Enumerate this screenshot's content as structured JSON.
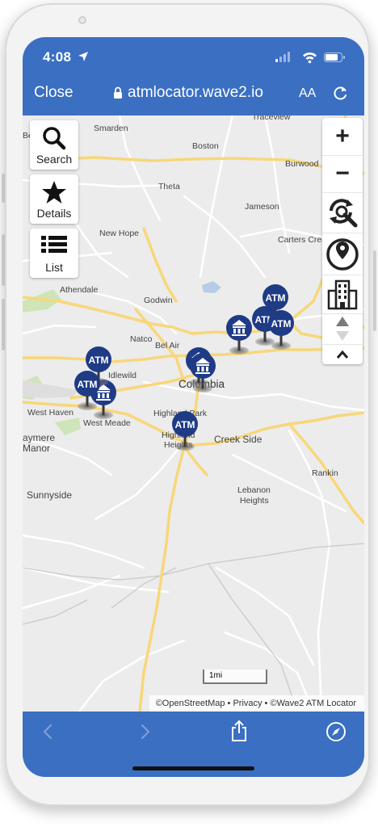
{
  "status": {
    "time": "4:08"
  },
  "browser": {
    "close_label": "Close",
    "url": "atmlocator.wave2.io",
    "text_size_label": "AA"
  },
  "controls": {
    "search_label": "Search",
    "details_label": "Details",
    "list_label": "List"
  },
  "map_controls": {
    "zoom_in": "+",
    "zoom_out": "−"
  },
  "places": {
    "traceview": "Traceview",
    "smarden": "Smarden",
    "boston": "Boston",
    "bethel": "Bethel",
    "burwood": "Burwood",
    "theta": "Theta",
    "jameson": "Jameson",
    "new_hope": "New Hope",
    "carters_creek": "Carters Cree",
    "athendale": "Athendale",
    "godwin": "Godwin",
    "natco": "Natco",
    "bel_air": "Bel Air",
    "idlewild": "Idlewild",
    "columbia": "Columbia",
    "west_haven": "West Haven",
    "west_meade": "West Meade",
    "highland_park": "Highland Park",
    "highland_heights_1": "Highland",
    "highland_heights_2": "Heights",
    "aymere_manor_1": "aymere",
    "aymere_manor_2": "Manor",
    "creek_side": "Creek Side",
    "rankin": "Rankin",
    "sunnyside": "Sunnyside",
    "lebanon_heights_1": "Lebanon",
    "lebanon_heights_2": "Heights"
  },
  "markers": {
    "atm_label": "ATM"
  },
  "scale_label": "1mi",
  "attribution": {
    "osm": "©OpenStreetMap",
    "sep": " • ",
    "privacy": "Privacy",
    "wave2": "©Wave2 ATM Locator"
  },
  "colors": {
    "browser_blue": "#3a6fc2",
    "marker_navy": "#1f3b86",
    "road_yellow": "#f8d77a",
    "park_green": "#cfe4b8",
    "water_blue": "#b5cde6"
  }
}
